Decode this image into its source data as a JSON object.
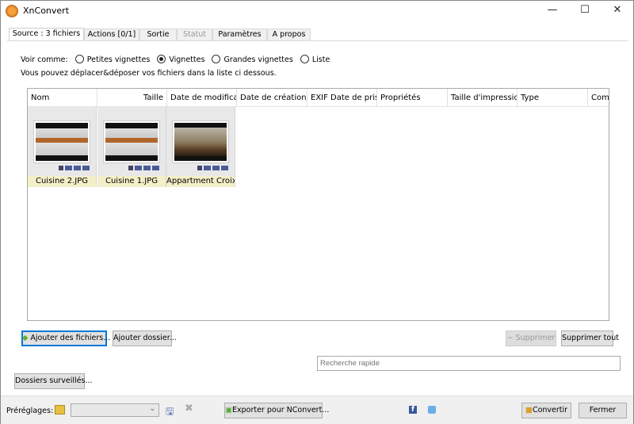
{
  "window": {
    "title": "XnConvert",
    "minimize": "—",
    "maximize": "☐",
    "close": "✕"
  },
  "tabs": [
    {
      "label": "Source : 3 fichiers"
    },
    {
      "label": "Actions [0/1]"
    },
    {
      "label": "Sortie"
    },
    {
      "label": "Statut"
    },
    {
      "label": "Paramètres"
    },
    {
      "label": "A propos"
    }
  ],
  "view": {
    "label": "Voir comme:",
    "options": [
      "Petites vignettes",
      "Vignettes",
      "Grandes vignettes",
      "Liste"
    ],
    "selected": "Vignettes"
  },
  "hint": "Vous pouvez déplacer&déposer vos fichiers dans la liste ci dessous.",
  "columns": [
    "Nom",
    "Taille",
    "Date de modifica",
    "Date de création",
    "EXIF Date de pris",
    "Propriétés",
    "Taille d'impressio",
    "Type",
    "Com"
  ],
  "files": [
    {
      "name": "Cuisine 2.JPG"
    },
    {
      "name": "Cuisine 1.JPG"
    },
    {
      "name": "Appartment Croix..."
    }
  ],
  "buttons": {
    "add_files": "Ajouter des fichiers...",
    "add_folder": "Ajouter dossier...",
    "remove": "Supprimer",
    "remove_all": "Supprimer tout",
    "watched": "Dossiers surveillés...",
    "export": "Exporter pour NConvert...",
    "convert": "Convertir",
    "close": "Fermer"
  },
  "search": {
    "placeholder": "Recherche rapide"
  },
  "presets": {
    "label": "Préréglages:",
    "value": ""
  }
}
